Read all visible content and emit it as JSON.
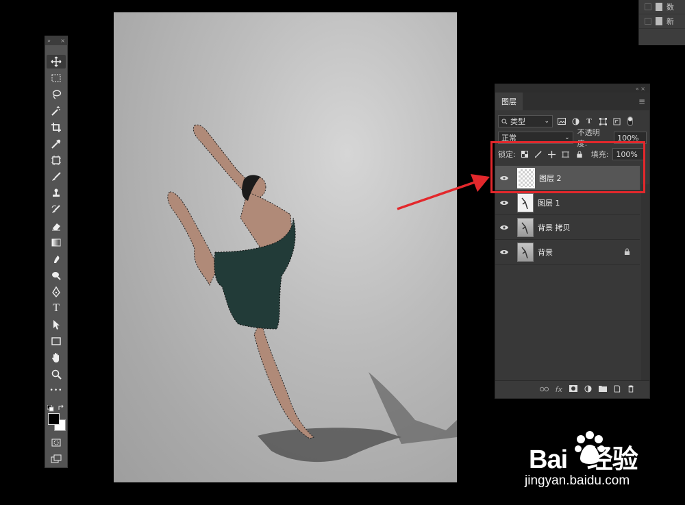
{
  "toolbar": {
    "header_left": "»",
    "header_right": "×",
    "tools": [
      "move-icon",
      "marquee-icon",
      "lasso-icon",
      "magic-wand-icon",
      "crop-icon",
      "eyedropper-icon",
      "frame-icon",
      "brush-icon",
      "stamp-icon",
      "history-brush-icon",
      "eraser-icon",
      "gradient-icon",
      "smudge-icon",
      "dodge-icon",
      "pen-icon",
      "type-icon",
      "path-select-icon",
      "rectangle-icon",
      "hand-icon",
      "zoom-icon",
      "more-icon"
    ],
    "type_glyph": "T",
    "more_glyph": "•••"
  },
  "peek_panel": {
    "items": [
      "数",
      "新"
    ]
  },
  "layers_panel": {
    "top_icons": "« ×",
    "tab": "图层",
    "menu_icon": "≡",
    "filter_label": "类型",
    "blend_mode": "正常",
    "opacity_label": "不透明度:",
    "opacity_value": "100%",
    "lock_label": "锁定:",
    "fill_label": "填充:",
    "fill_value": "100%",
    "layers": [
      {
        "name": "图层 2",
        "selected": true,
        "thumb": "transparent"
      },
      {
        "name": "图层 1",
        "selected": false,
        "thumb": "cutout"
      },
      {
        "name": "背景 拷贝",
        "selected": false,
        "thumb": "photo"
      },
      {
        "name": "背景",
        "selected": false,
        "thumb": "photo",
        "locked": true
      }
    ],
    "bottom_fx": "fx"
  },
  "annotation": {
    "box_color": "#e3282c",
    "arrow_color": "#e3282c"
  },
  "watermark": {
    "logo": "Bai   经验",
    "url": "jingyan.baidu.com"
  }
}
